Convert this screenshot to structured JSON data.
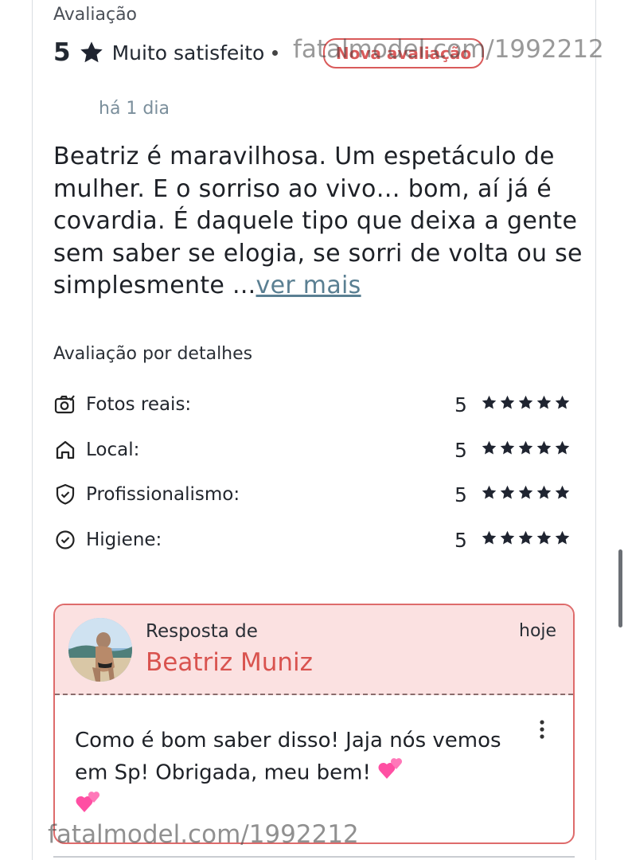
{
  "review": {
    "eyebrow": "Avaliação",
    "score": "5",
    "satisfaction": "Muito satisfeito",
    "badge": "Nova avaliação",
    "posted": "há 1 dia",
    "text": "Beatriz é maravilhosa. Um espetáculo de mulher. E o sorriso ao vivo… bom, aí já é covardia. É daquele tipo que deixa a gente sem saber se elogia, se sorri de volta ou se simplesmente ...",
    "more_link": "ver mais"
  },
  "details": {
    "title": "Avaliação por detalhes",
    "items": [
      {
        "label": "Fotos reais:",
        "score": "5",
        "stars": 5,
        "icon": "camera-icon"
      },
      {
        "label": "Local:",
        "score": "5",
        "stars": 5,
        "icon": "home-icon"
      },
      {
        "label": "Profissionalismo:",
        "score": "5",
        "stars": 5,
        "icon": "shield-check-icon"
      },
      {
        "label": "Higiene:",
        "score": "5",
        "stars": 5,
        "icon": "check-circle-icon"
      }
    ]
  },
  "reply": {
    "from_label": "Resposta de",
    "name": "Beatriz Muniz",
    "time": "hoje",
    "text": "Como é bom saber disso! Jaja nós vemos em Sp! Obrigada, meu bem!"
  },
  "watermark": {
    "top": "fatalmodel.com/1992212",
    "bottom": "fatalmodel.com/1992212"
  },
  "colors": {
    "accent": "#d9534f",
    "link": "#5a7f92",
    "reply_bg": "#fbe1e1",
    "star": "#1f2430"
  }
}
